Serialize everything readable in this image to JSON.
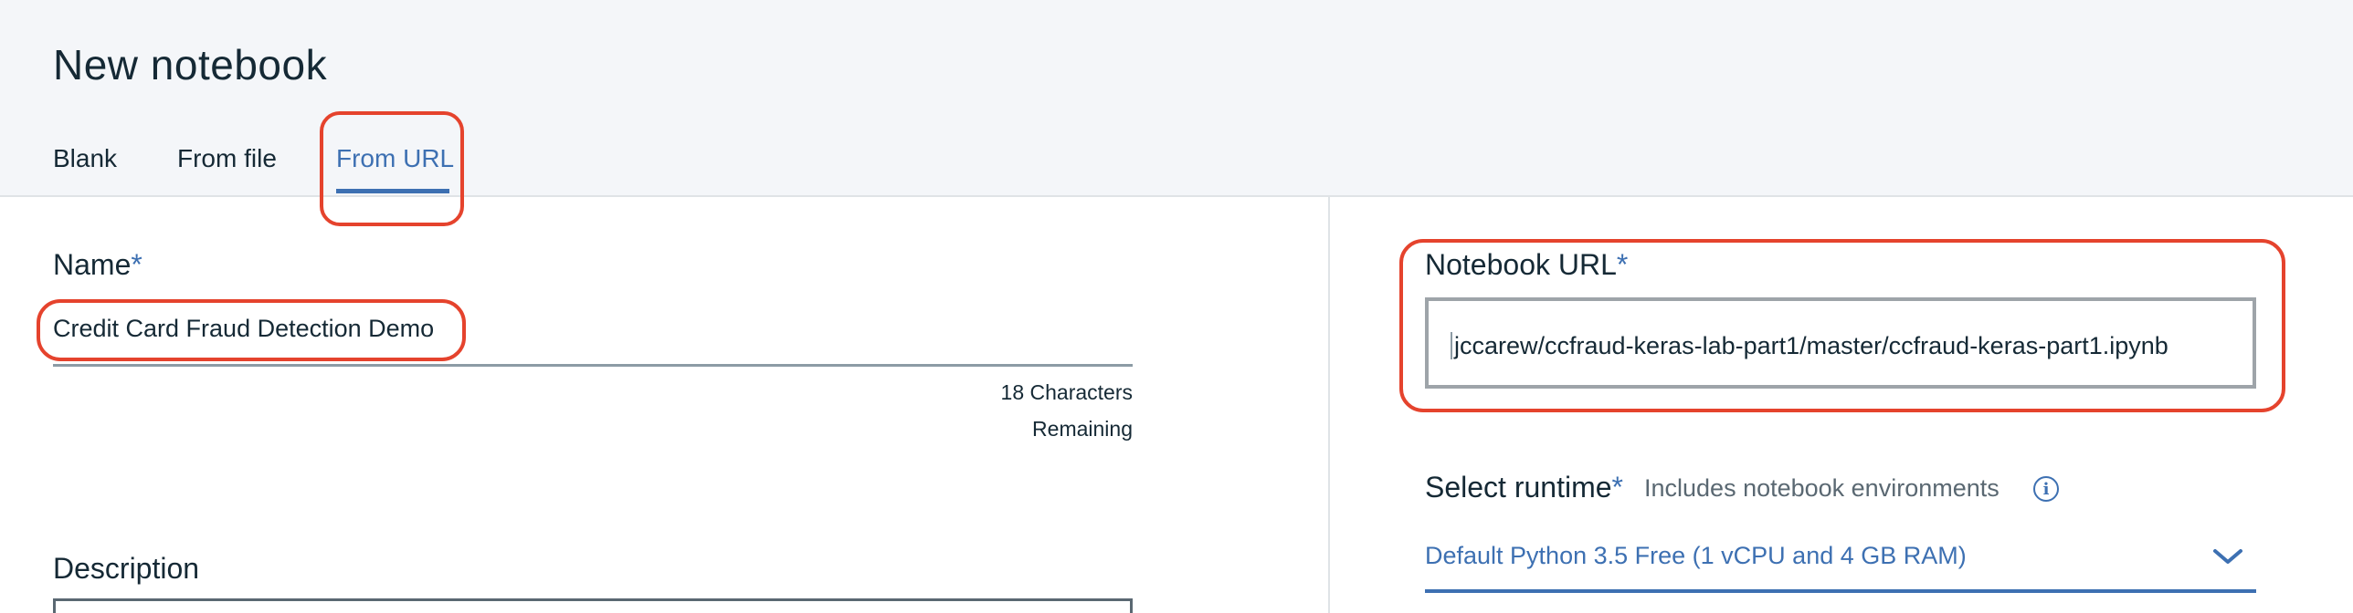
{
  "header": {
    "title": "New notebook",
    "tabs": [
      {
        "label": "Blank"
      },
      {
        "label": "From file"
      },
      {
        "label": "From URL"
      }
    ]
  },
  "left": {
    "name": {
      "label": "Name",
      "required_marker": "*",
      "value": "Credit Card Fraud Detection Demo",
      "counter_line1": "18 Characters",
      "counter_line2": "Remaining"
    },
    "description": {
      "label": "Description"
    }
  },
  "right": {
    "url": {
      "label": "Notebook URL",
      "required_marker": "*",
      "value": "jccarew/ccfraud-keras-lab-part1/master/ccfraud-keras-part1.ipynb"
    },
    "runtime": {
      "label": "Select runtime",
      "required_marker": "*",
      "hint": "Includes notebook environments",
      "selected": "Default Python 3.5 Free (1 vCPU and 4 GB RAM)"
    }
  },
  "colors": {
    "accent": "#3d70b2",
    "callout": "#e5432d",
    "header_bg": "#f4f6f9"
  },
  "icons": {
    "info": "info-icon",
    "dropdown": "chevron-down-icon"
  }
}
